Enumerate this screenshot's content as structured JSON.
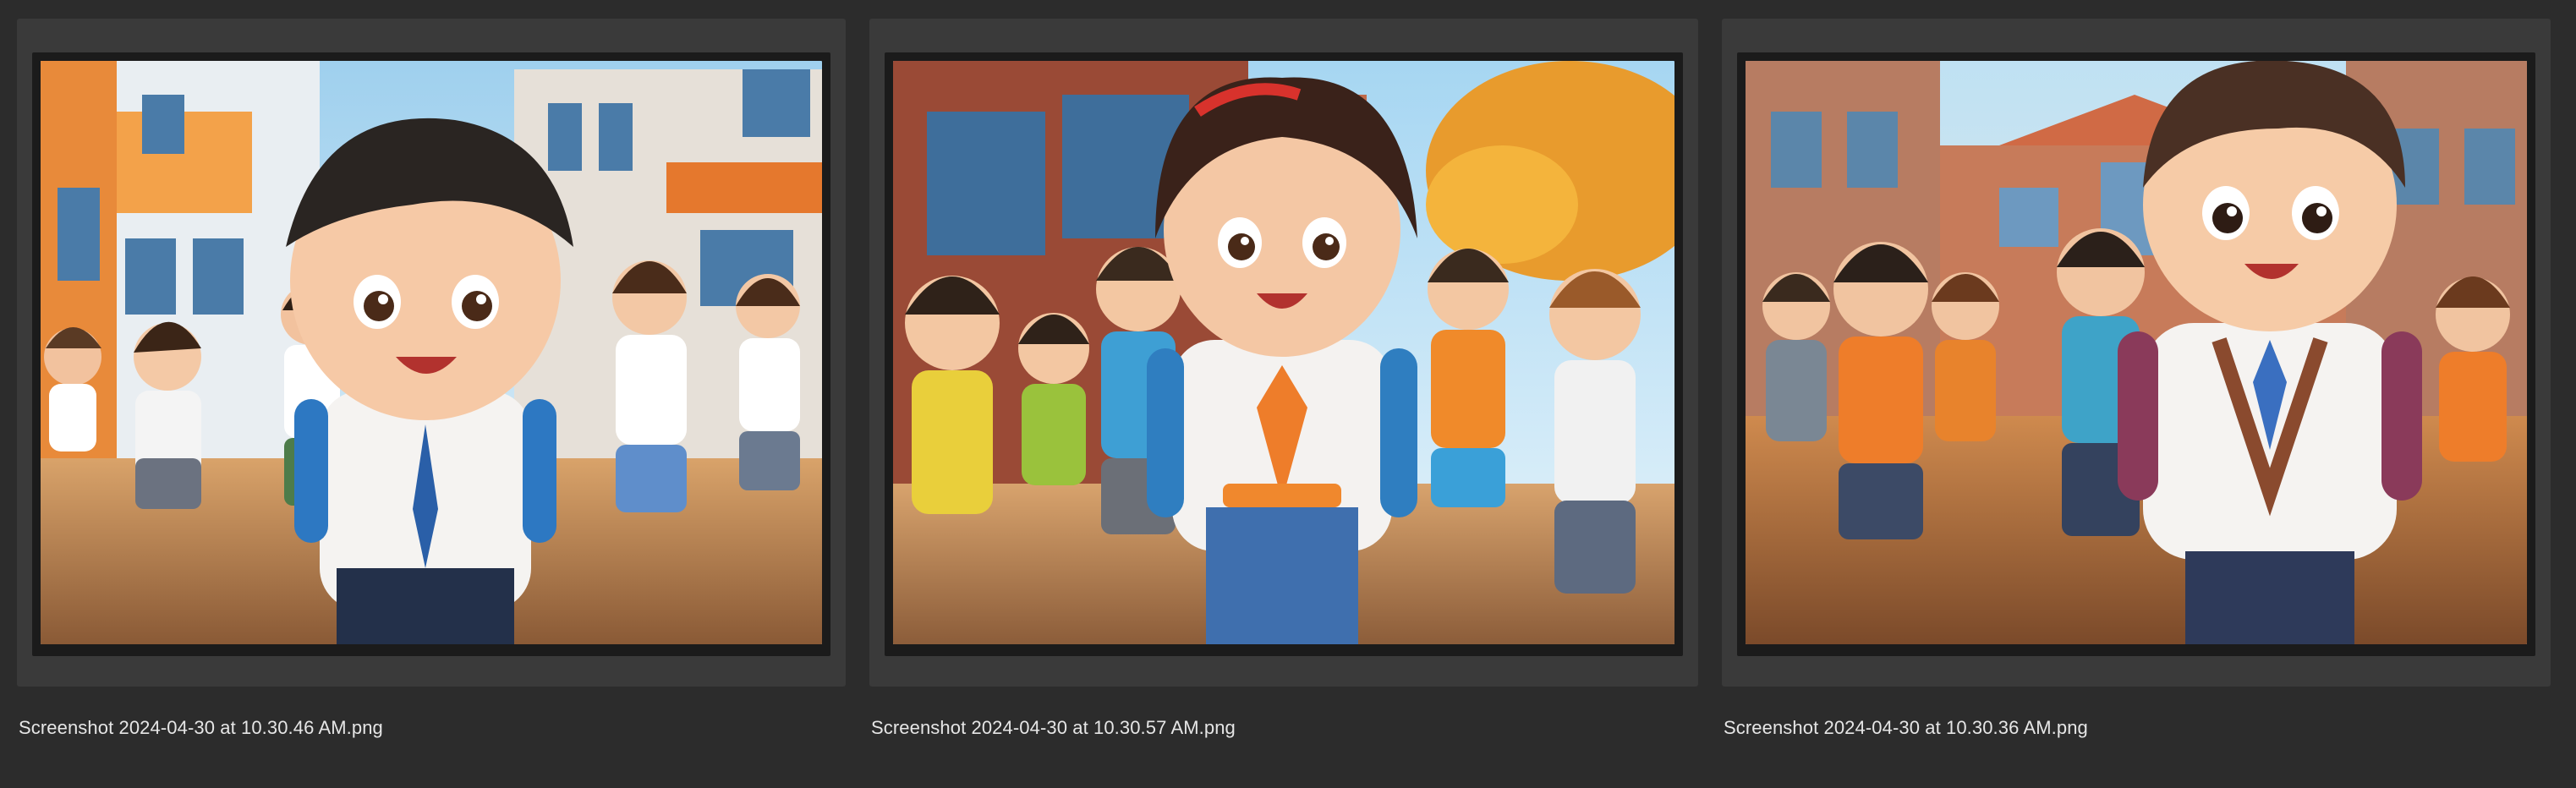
{
  "browser": {
    "items": [
      {
        "filename": "Screenshot 2024-04-30 at 10.30.46 AM.png",
        "thumbnail_alt": "Cartoon school children running on a sidewalk in front of orange buildings"
      },
      {
        "filename": "Screenshot 2024-04-30 at 10.30.57 AM.png",
        "thumbnail_alt": "Cartoon school children with backpacks running under autumn trees"
      },
      {
        "filename": "Screenshot 2024-04-30 at 10.30.36 AM.png",
        "thumbnail_alt": "Cartoon school children running toward a brick school building"
      }
    ]
  },
  "colors": {
    "background": "#2c2c2c",
    "cell": "#3a3a3a",
    "frame": "#1b1b1b",
    "filename_text": "#e6e6e6"
  }
}
